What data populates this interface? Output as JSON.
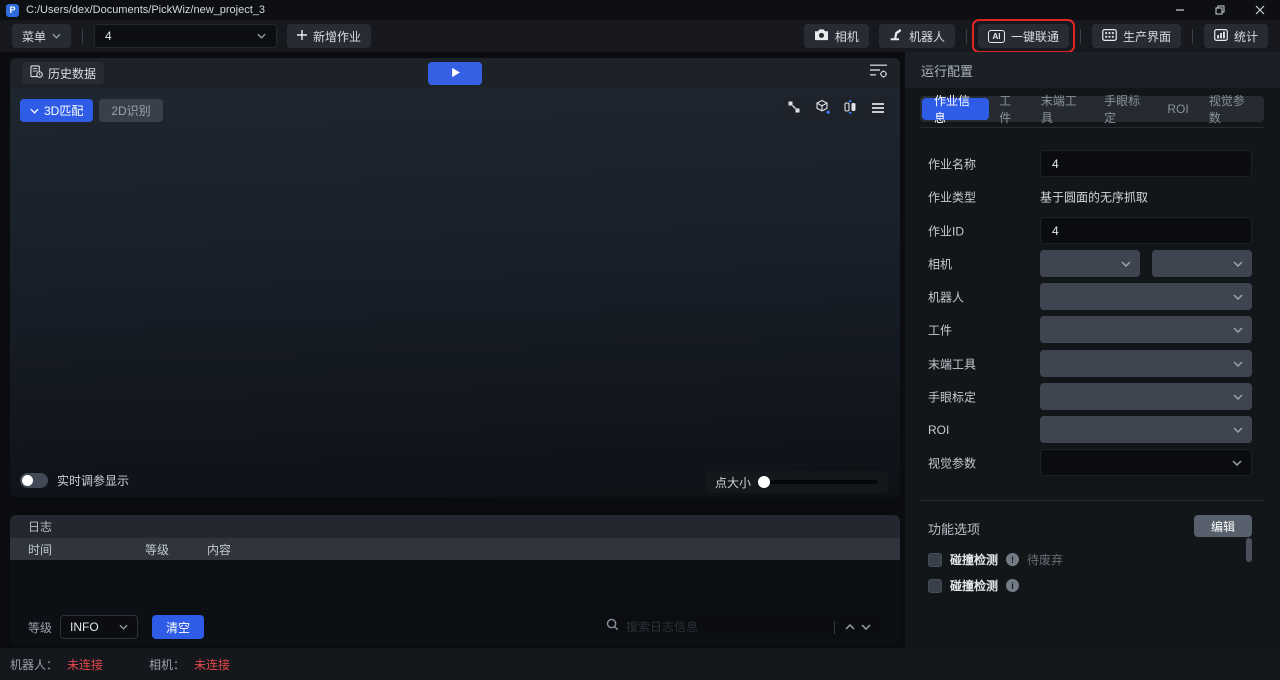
{
  "window": {
    "logo_text": "P",
    "title": "C:/Users/dex/Documents/PickWiz/new_project_3"
  },
  "toolbar": {
    "menu": "菜单",
    "job_select": "4",
    "add_job": "新增作业",
    "camera": "相机",
    "robot": "机器人",
    "one_key_ai": "AI",
    "one_key": "一键联通",
    "production": "生产界面",
    "stats": "统计"
  },
  "viewport": {
    "history": "历史数据",
    "match_3d": "3D匹配",
    "recognize_2d": "2D识别",
    "realtime_label": "实时调参显示",
    "point_size_label": "点大小"
  },
  "log": {
    "title": "日志",
    "col_time": "时间",
    "col_level": "等级",
    "col_content": "内容",
    "level_label": "等级",
    "level_value": "INFO",
    "clear": "清空",
    "search_placeholder": "搜索日志信息"
  },
  "config": {
    "title": "运行配置",
    "tabs": [
      {
        "label": "作业信息",
        "active": true
      },
      {
        "label": "工件",
        "active": false
      },
      {
        "label": "末端工具",
        "active": false
      },
      {
        "label": "手眼标定",
        "active": false
      },
      {
        "label": "ROI",
        "active": false
      },
      {
        "label": "视觉参数",
        "active": false
      }
    ],
    "fields": {
      "job_name": {
        "label": "作业名称",
        "value": "4"
      },
      "job_type": {
        "label": "作业类型",
        "value": "基于圆面的无序抓取"
      },
      "job_id": {
        "label": "作业ID",
        "value": "4"
      },
      "camera": {
        "label": "相机"
      },
      "robot": {
        "label": "机器人"
      },
      "workpiece": {
        "label": "工件"
      },
      "end_tool": {
        "label": "末端工具"
      },
      "hand_eye": {
        "label": "手眼标定"
      },
      "roi": {
        "label": "ROI"
      },
      "vision_params": {
        "label": "视觉参数"
      }
    },
    "function_options": {
      "title": "功能选项",
      "edit": "编辑",
      "items": [
        {
          "label": "碰撞检测",
          "icon_glyph": "!",
          "badge": "待废弃",
          "checked": false
        },
        {
          "label": "碰撞检测",
          "icon_glyph": "i",
          "badge": "",
          "checked": false
        }
      ]
    }
  },
  "status_bar": {
    "robot_label": "机器人：",
    "robot_value": "未连接",
    "camera_label": "相机：",
    "camera_value": "未连接"
  },
  "colors": {
    "accent_blue": "#3560e4",
    "tab_active_blue": "#2e5ce6",
    "highlight_red": "#e02525",
    "error_red": "#e5484d"
  }
}
